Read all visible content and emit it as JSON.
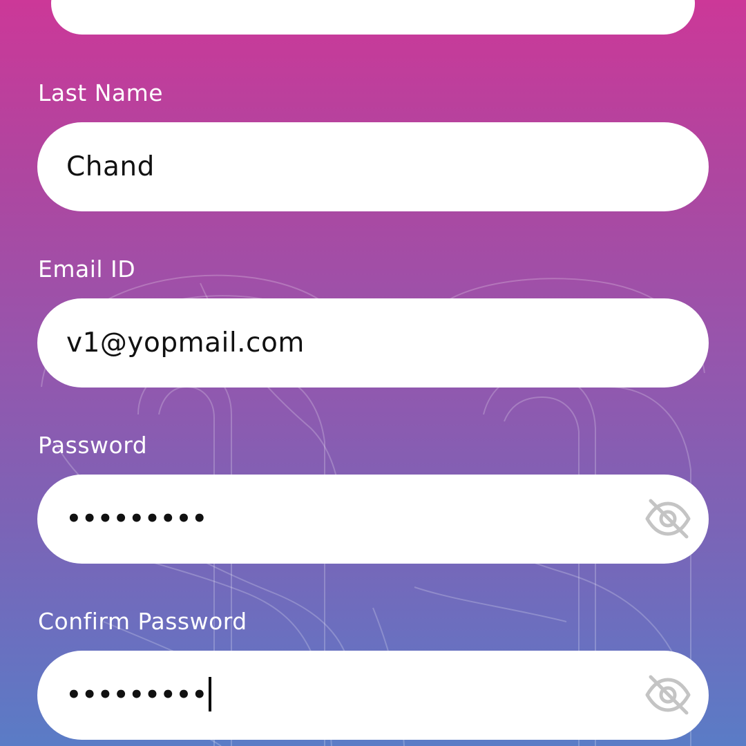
{
  "form": {
    "last_name": {
      "label": "Last Name",
      "value": "Chand"
    },
    "email": {
      "label": "Email ID",
      "value": "v1@yopmail.com"
    },
    "password": {
      "label": "Password",
      "value": "•••••••••",
      "toggle_icon": "eye-off-icon"
    },
    "confirm_password": {
      "label": "Confirm Password",
      "value": "•••••••••",
      "toggle_icon": "eye-off-icon"
    }
  },
  "colors": {
    "gradient_top": "#cc3898",
    "gradient_bottom": "#5a7cc6",
    "field_background": "#ffffff",
    "label_text": "#ffffff",
    "icon_gray": "#c4c4c4"
  }
}
